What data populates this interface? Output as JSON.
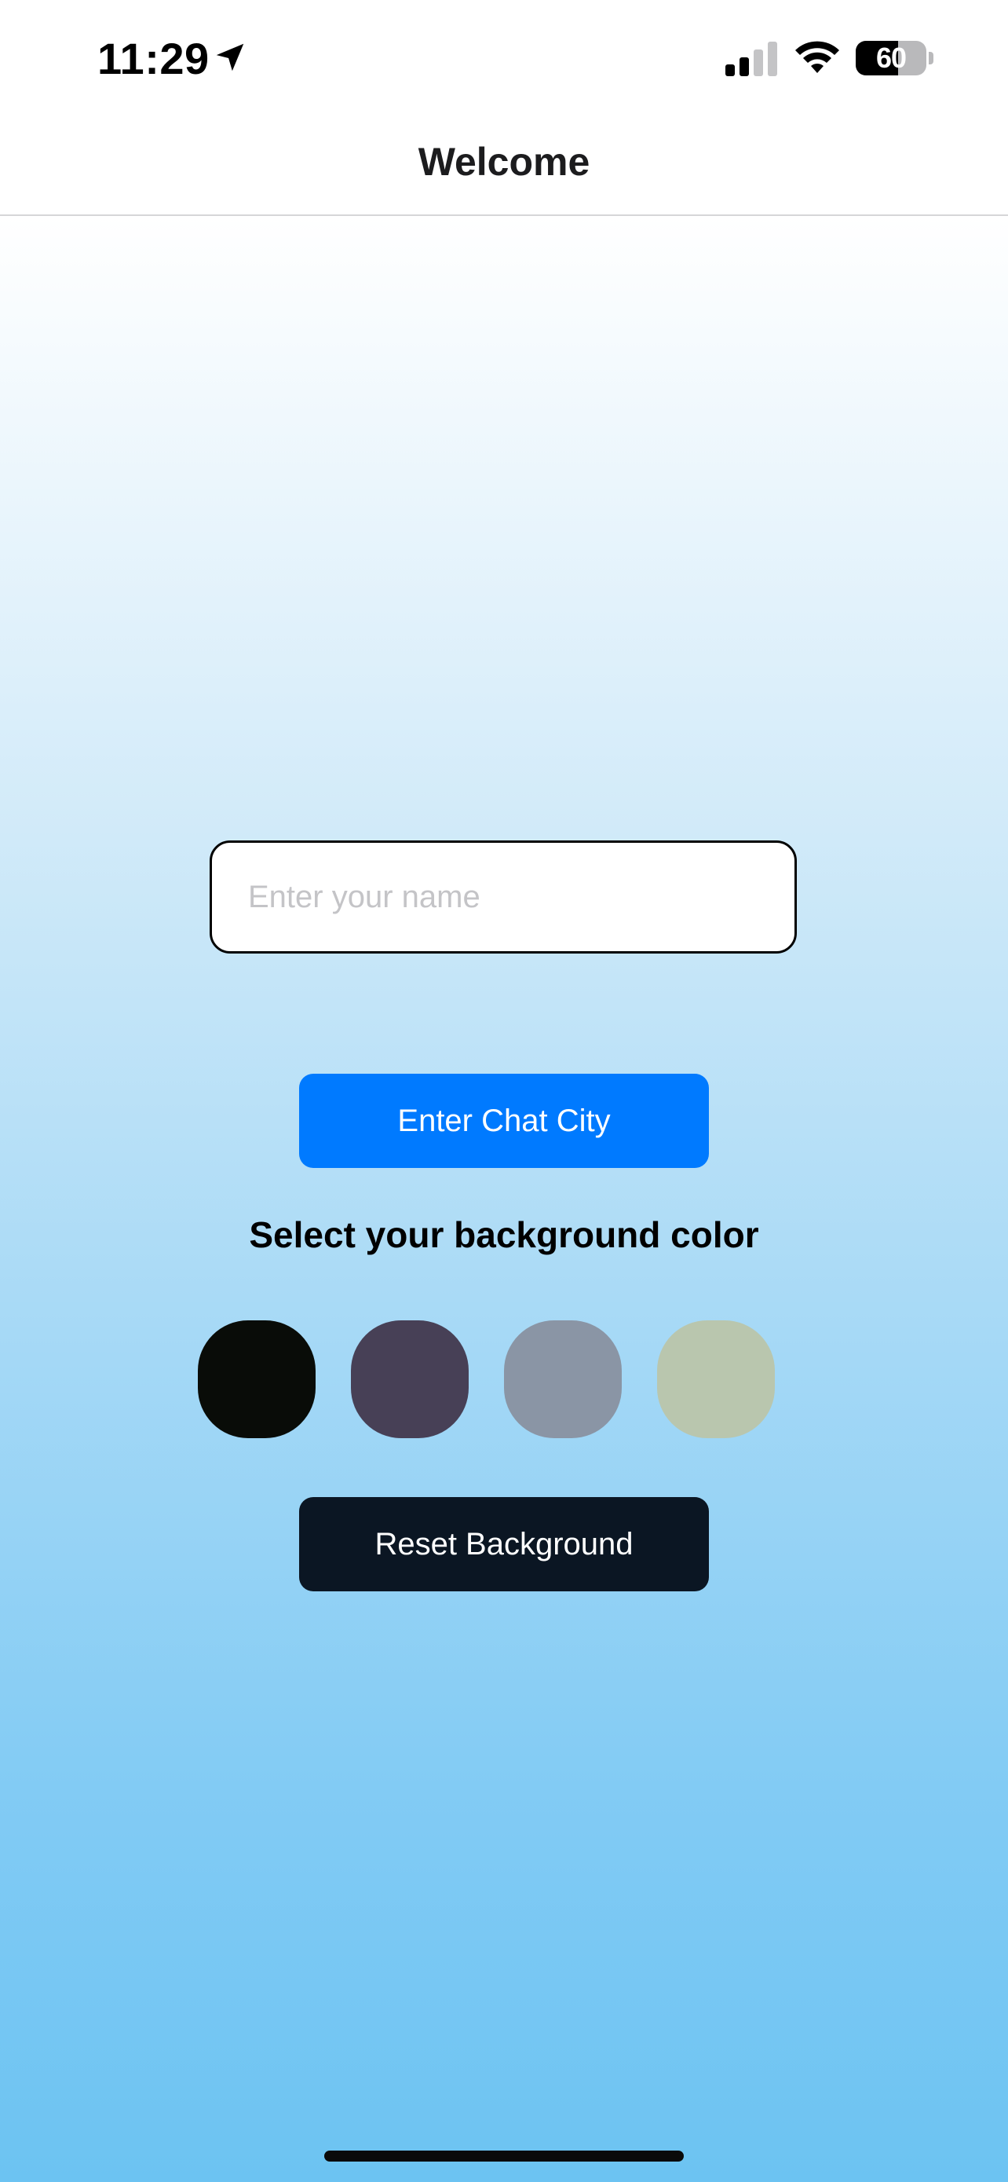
{
  "status_bar": {
    "time": "11:29",
    "battery_level": "60",
    "battery_fraction": 0.6,
    "icons": [
      "location-arrow-icon",
      "cellular-signal-icon",
      "wifi-icon",
      "battery-icon"
    ]
  },
  "nav": {
    "title": "Welcome"
  },
  "form": {
    "name_placeholder": "Enter your name",
    "name_value": ""
  },
  "buttons": {
    "enter": "Enter Chat City",
    "reset": "Reset Background"
  },
  "color_picker": {
    "label": "Select your background color",
    "swatches": [
      {
        "color": "#090C08"
      },
      {
        "color": "#474056"
      },
      {
        "color": "#8A95A5"
      },
      {
        "color": "#B9C6AE"
      }
    ]
  },
  "colors": {
    "accent": "#007AFF",
    "reset_button": "#0B1623",
    "gradient_top": "#FFFFFF",
    "gradient_bottom": "#6CC3F2"
  }
}
